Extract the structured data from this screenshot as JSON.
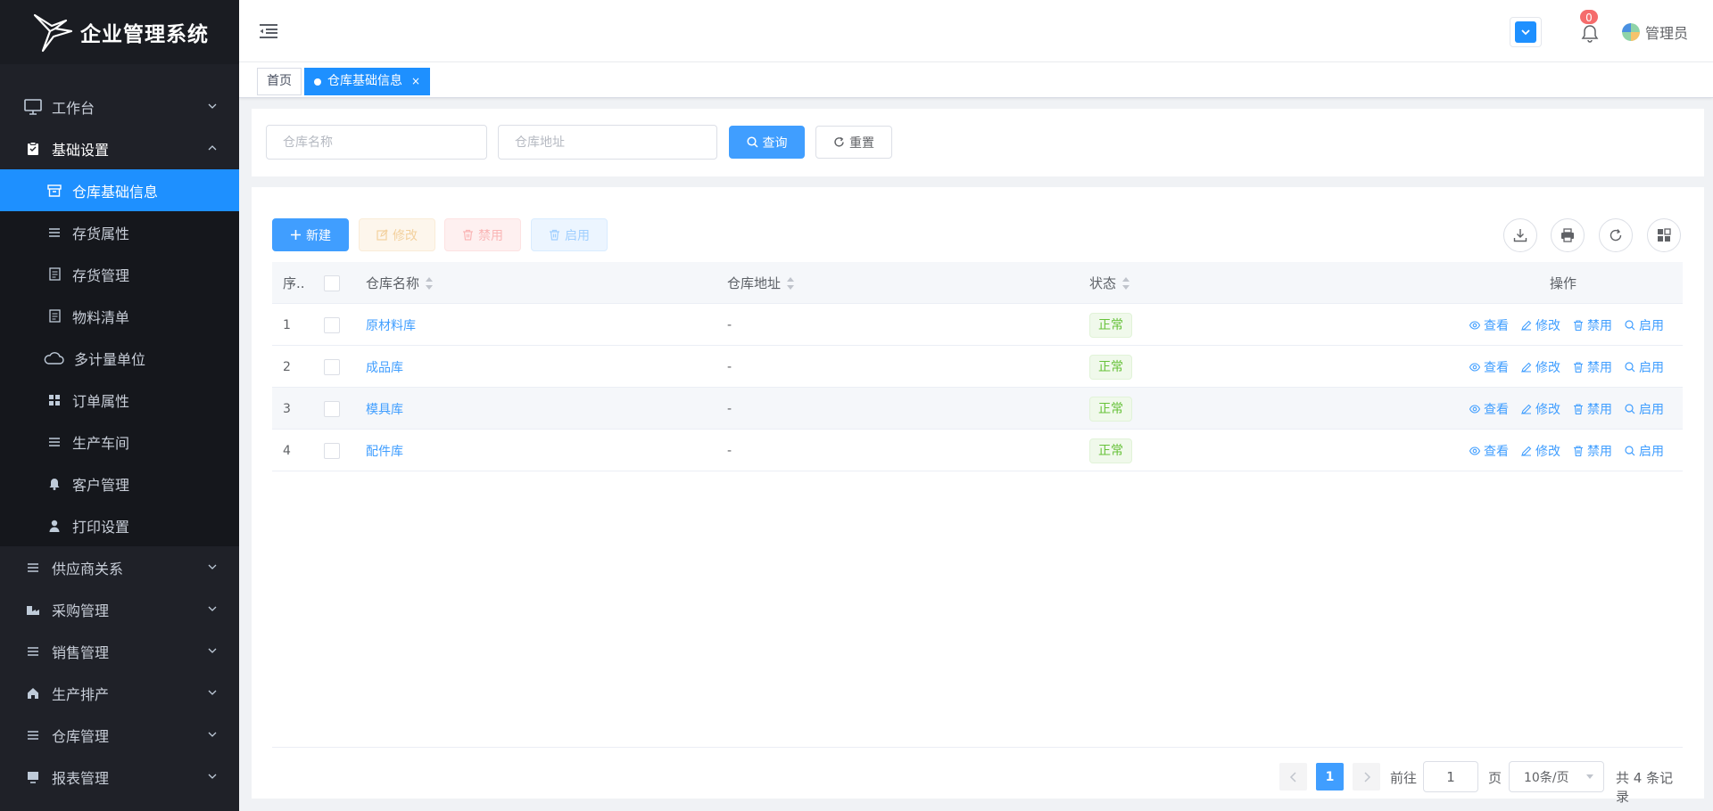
{
  "app": {
    "title": "企业管理系统"
  },
  "sidebar": {
    "items": [
      {
        "label": "工作台",
        "icon": "monitor-icon",
        "open": false
      },
      {
        "label": "基础设置",
        "icon": "clipboard-icon",
        "open": true,
        "children": [
          {
            "label": "仓库基础信息",
            "icon": "warehouse-icon",
            "active": true
          },
          {
            "label": "存货属性",
            "icon": "list-icon"
          },
          {
            "label": "存货管理",
            "icon": "document-icon"
          },
          {
            "label": "物料清单",
            "icon": "document-icon"
          },
          {
            "label": "多计量单位",
            "icon": "cloud-icon"
          },
          {
            "label": "订单属性",
            "icon": "grid-icon"
          },
          {
            "label": "生产车间",
            "icon": "list-icon"
          },
          {
            "label": "客户管理",
            "icon": "bell-icon"
          },
          {
            "label": "打印设置",
            "icon": "user-icon"
          }
        ]
      },
      {
        "label": "供应商关系",
        "icon": "list-icon"
      },
      {
        "label": "采购管理",
        "icon": "cart-icon"
      },
      {
        "label": "销售管理",
        "icon": "list-icon"
      },
      {
        "label": "生产排产",
        "icon": "home-icon"
      },
      {
        "label": "仓库管理",
        "icon": "list-icon"
      },
      {
        "label": "报表管理",
        "icon": "monitor-icon"
      }
    ]
  },
  "header": {
    "notification_count": "0",
    "user_name": "管理员"
  },
  "tabs": [
    {
      "label": "首页"
    },
    {
      "label": "仓库基础信息",
      "active": true,
      "close": "×"
    }
  ],
  "search": {
    "name_placeholder": "仓库名称",
    "address_placeholder": "仓库地址",
    "query_label": "查询",
    "reset_label": "重置"
  },
  "toolbar": {
    "new_label": "新建",
    "edit_label": "修改",
    "disable_label": "禁用",
    "enable_label": "启用"
  },
  "table": {
    "columns": {
      "index": "序..",
      "name": "仓库名称",
      "address": "仓库地址",
      "status": "状态",
      "actions": "操作"
    },
    "rows": [
      {
        "index": "1",
        "name": "原材料库",
        "address": "-",
        "status": "正常"
      },
      {
        "index": "2",
        "name": "成品库",
        "address": "-",
        "status": "正常"
      },
      {
        "index": "3",
        "name": "模具库",
        "address": "-",
        "status": "正常"
      },
      {
        "index": "4",
        "name": "配件库",
        "address": "-",
        "status": "正常"
      }
    ],
    "row_actions": {
      "view": "查看",
      "edit": "修改",
      "disable": "禁用",
      "enable": "启用"
    }
  },
  "pagination": {
    "current_page": "1",
    "goto_label": "前往",
    "goto_value": "1",
    "page_label": "页",
    "page_size": "10条/页",
    "total": "共 4 条记录"
  },
  "colors": {
    "primary": "#409eff",
    "sidebar_bg": "#1f2128",
    "active_menu": "#1e90ff",
    "success": "#67c23a",
    "warning": "#e6a23c",
    "danger": "#f56c6c"
  }
}
